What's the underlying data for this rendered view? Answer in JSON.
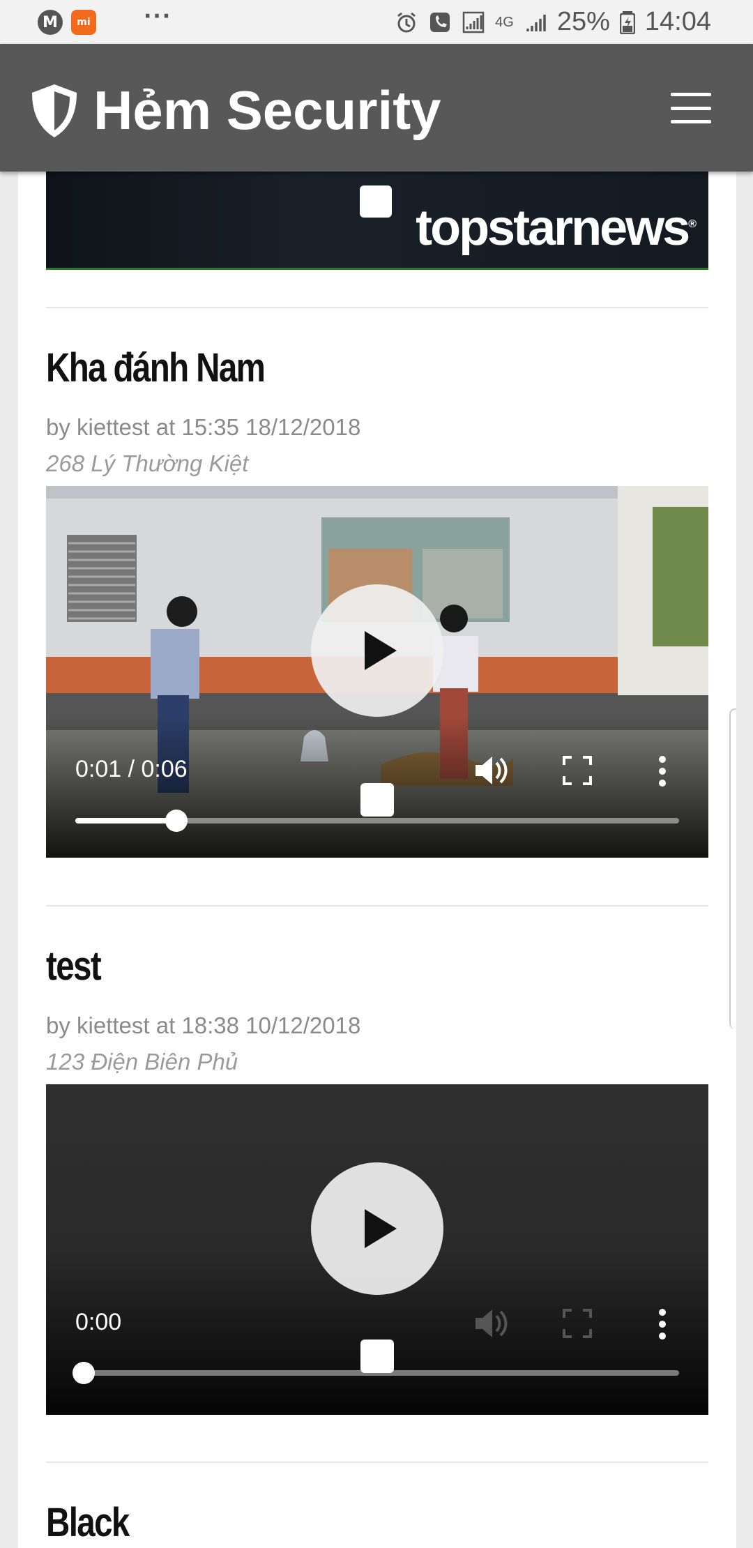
{
  "status_bar": {
    "left_icons": [
      "moto-icon",
      "mi-icon"
    ],
    "m_label": "M",
    "mi_label": "mi",
    "more": "···",
    "network": "4G",
    "battery": "25%",
    "time": "14:04"
  },
  "header": {
    "title": "Hẻm Security"
  },
  "ad": {
    "logo": "topstarnews",
    "mark": "®"
  },
  "posts": [
    {
      "title": "Kha đánh Nam",
      "meta": "by kiettest at 15:35 18/12/2018",
      "address": "268 Lý Thường Kiệt",
      "video": {
        "time": "0:01 / 0:06",
        "progress": 0.167
      }
    },
    {
      "title": "test",
      "meta": "by kiettest at 18:38 10/12/2018",
      "address": "123 Điện Biên Phủ",
      "video": {
        "time": "0:00",
        "progress": 0.0
      }
    },
    {
      "title": "Black"
    }
  ],
  "colors": {
    "header_bg": "#585858",
    "status_bg": "#f2f2f2",
    "meta_text": "#8a8a8a"
  }
}
